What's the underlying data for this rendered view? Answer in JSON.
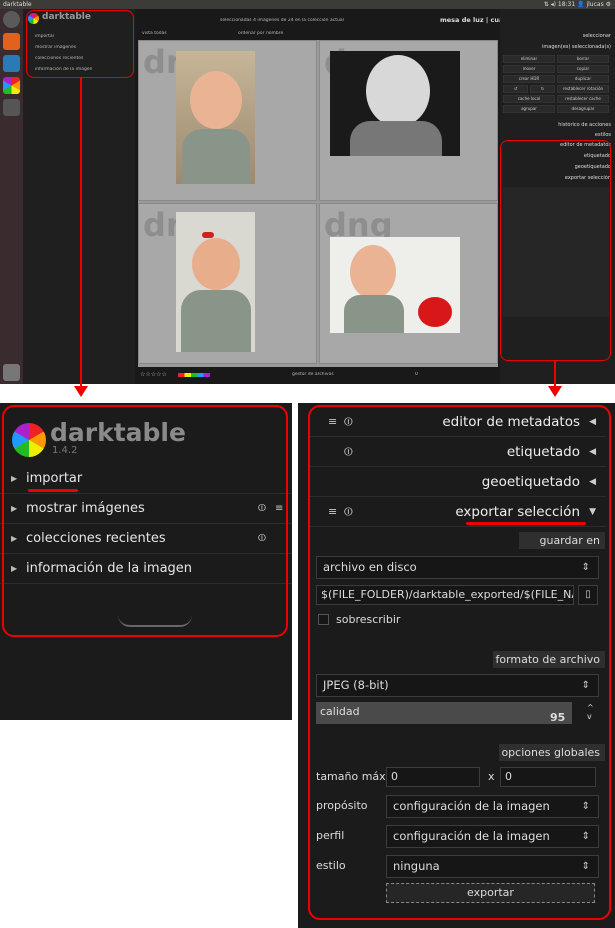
{
  "window_title": "darktable",
  "panel_clock": "⇅ ◂) 18:31 👤 jlucas ⚙",
  "app": {
    "name": "darktable",
    "version": "1.4.2"
  },
  "top": {
    "status": "seleccionadas 4 imágenes de 24 en la colección actual",
    "views": "mesa de luz | cuarto oscuro | captura | mapa"
  },
  "filter": {
    "view": "vista",
    "view_val": "todas",
    "sort": "ordenar por",
    "sort_val": "nombre"
  },
  "left_modules": [
    {
      "label": "importar"
    },
    {
      "label": "mostrar imágenes"
    },
    {
      "label": "colecciones recientes"
    },
    {
      "label": "información de la imagen"
    }
  ],
  "thumbs": [
    {
      "ext": "dng"
    },
    {
      "ext": "dng"
    },
    {
      "ext": "dng"
    },
    {
      "ext": "dng"
    }
  ],
  "right_small": {
    "select": "seleccionar",
    "selected": "imagen(es) seleccionada(s)",
    "buttons": [
      "eliminar",
      "borrar",
      "mover",
      "copiar",
      "crear HDR",
      "duplicar",
      "↺",
      "↻",
      "restablecer rotación",
      "cache local",
      "restablecer cache",
      "agrupar",
      "desagrupar"
    ],
    "history": "histórico de acciones",
    "styles": "estilos"
  },
  "bottom_bar": {
    "stars": "☆☆☆☆☆",
    "gesture": "gestor de archivos",
    "page": "0"
  },
  "right_modules": [
    {
      "label": "editor de metadatos"
    },
    {
      "label": "etiquetado"
    },
    {
      "label": "geoetiquetado"
    },
    {
      "label": "exportar selección"
    }
  ],
  "export": {
    "save_section": "guardar en",
    "target": "archivo en disco",
    "path": "$(FILE_FOLDER)/darktable_exported/$(FILE_NAI",
    "overwrite": "sobrescribir",
    "format_section": "formato de archivo",
    "format": "JPEG (8-bit)",
    "quality_label": "calidad",
    "quality": "95",
    "global_section": "opciones globales",
    "max_size_label": "tamaño máx",
    "width": "0",
    "x": "x",
    "height": "0",
    "purpose_label": "propósito",
    "purpose": "configuración de la imagen",
    "profile_label": "perfil",
    "profile": "configuración de la imagen",
    "style_label": "estilo",
    "style": "ninguna",
    "export_button": "exportar"
  },
  "colors": {
    "accent": "#e00000",
    "panel": "#1f1f1f"
  }
}
